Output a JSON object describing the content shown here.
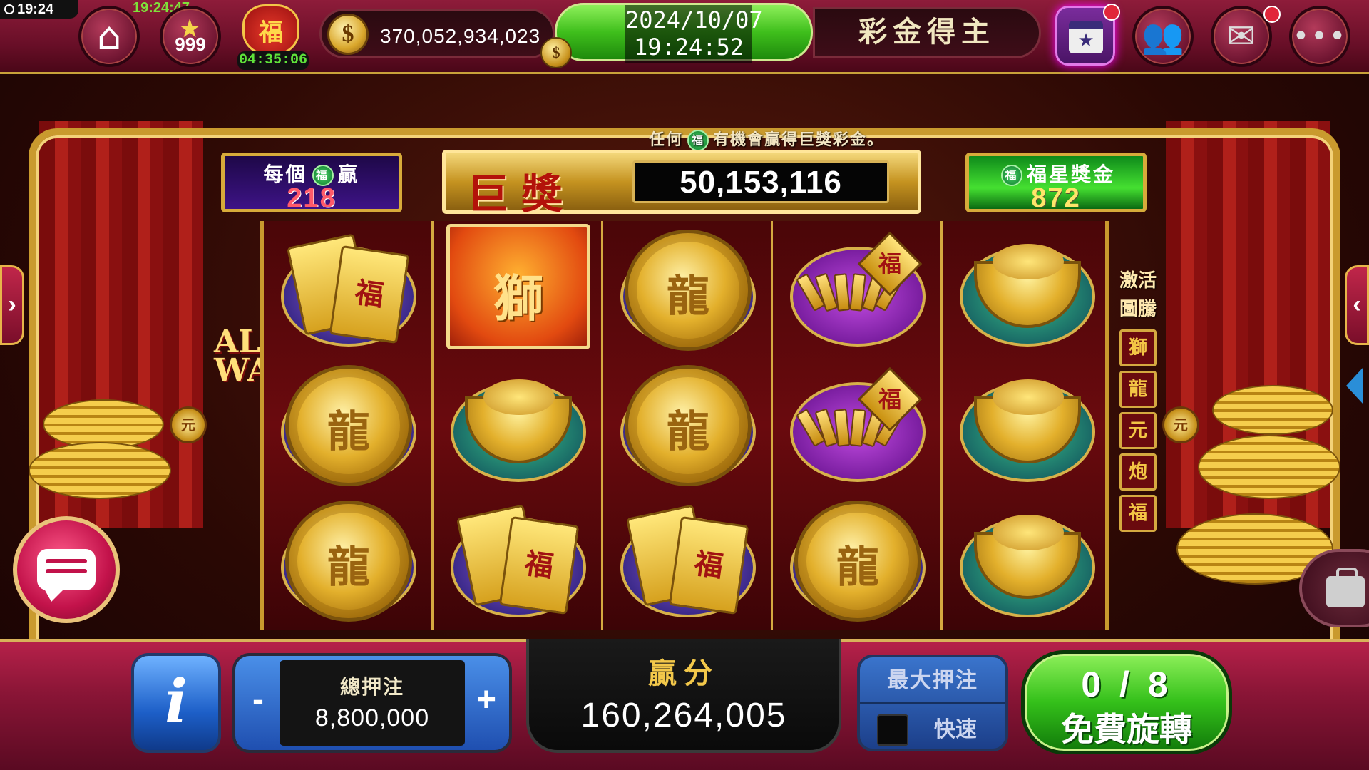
{
  "system": {
    "clock": "19:24"
  },
  "topbar": {
    "uptime": "19:24:47",
    "level": "999",
    "fu_bag_label": "福",
    "fu_bag_timer": "04:35:06",
    "coin_symbol": "$",
    "coins": "370,052,934,023",
    "date": "2024/10/07",
    "time": "19:24:52",
    "winner_text": "彩金得主"
  },
  "announcement": {
    "prefix": "任何",
    "icon_text": "福",
    "suffix": "有機會贏得巨獎彩金。"
  },
  "prizes": {
    "each_title_a": "每個",
    "each_title_b": "贏",
    "each_value": "218",
    "jackpot_title": "巨獎",
    "jackpot_value": "50,153,116",
    "star_title": "福星獎金",
    "star_value": "872",
    "fu_icon": "福"
  },
  "reel_side": {
    "allways": "ALL WAYS",
    "activate_1": "激活",
    "activate_2": "圖騰"
  },
  "reels": [
    [
      "envelope",
      "dragon-coin",
      "dragon-coin"
    ],
    [
      "lion",
      "ingot",
      "envelope"
    ],
    [
      "dragon-coin",
      "dragon-coin",
      "envelope"
    ],
    [
      "firecracker",
      "firecracker",
      "dragon-coin"
    ],
    [
      "ingot",
      "ingot",
      "ingot"
    ]
  ],
  "symbols": {
    "envelope_char": "福",
    "tag_char": "福"
  },
  "totems": [
    "獅",
    "龍",
    "元",
    "炮",
    "福"
  ],
  "bottombar": {
    "info_label": "i",
    "bet_label": "總押注",
    "bet_value": "8,800,000",
    "bet_minus": "-",
    "bet_plus": "+",
    "win_label": "贏分",
    "win_value": "160,264,005",
    "maxbet_label": "最大押注",
    "fast_label": "快速",
    "freespin_count": "0 / 8",
    "freespin_label": "免費旋轉"
  },
  "colors": {
    "accent_gold": "#d7ab3a",
    "spin_green": "#34c01a",
    "bar_crimson": "#8a1536"
  }
}
